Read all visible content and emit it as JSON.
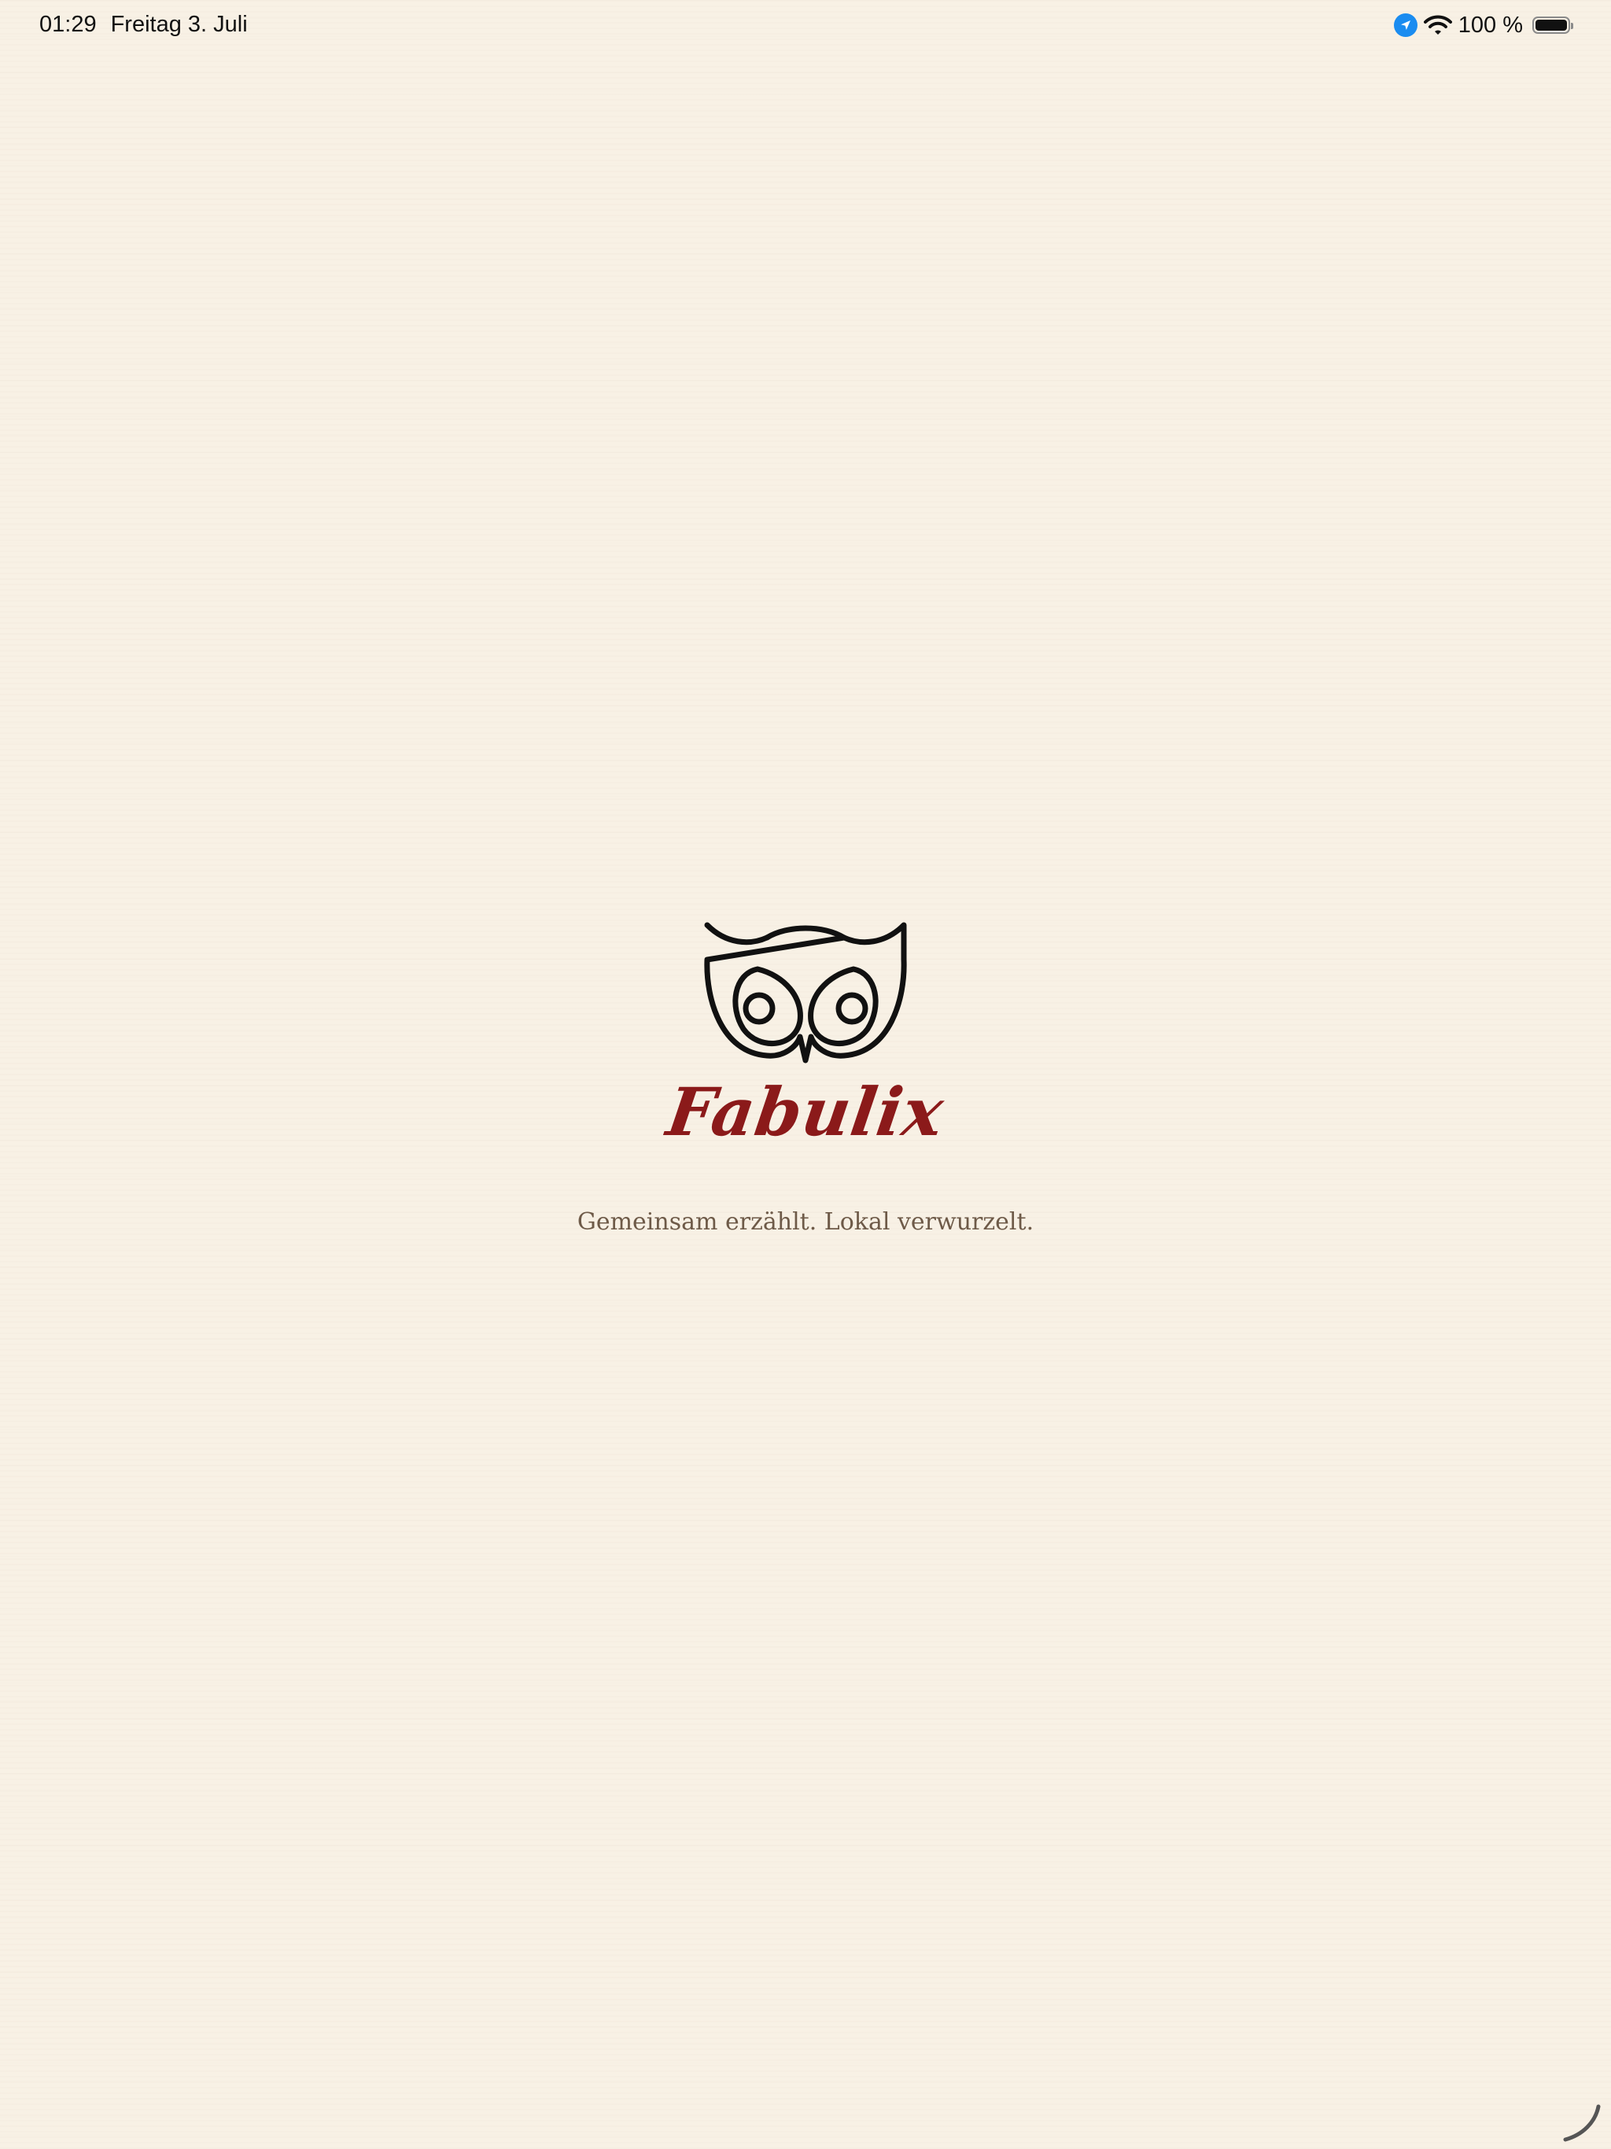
{
  "status_bar": {
    "time": "01:29",
    "date": "Freitag 3. Juli",
    "battery_percent": "100 %",
    "battery_level": 1.0,
    "icons": [
      "location-icon",
      "wifi-icon",
      "battery-icon"
    ],
    "location_color": "#1a8cf0"
  },
  "splash": {
    "logo_icon": "owl-icon",
    "brand_name": "Fabulix",
    "tagline": "Gemeinsam erzählt. Lokal verwurzelt.",
    "brand_color": "#8b1a1a",
    "tagline_color": "#6e5a48",
    "background_color": "#f8f1e5"
  },
  "loading": {
    "icon": "loading-spinner-icon"
  }
}
